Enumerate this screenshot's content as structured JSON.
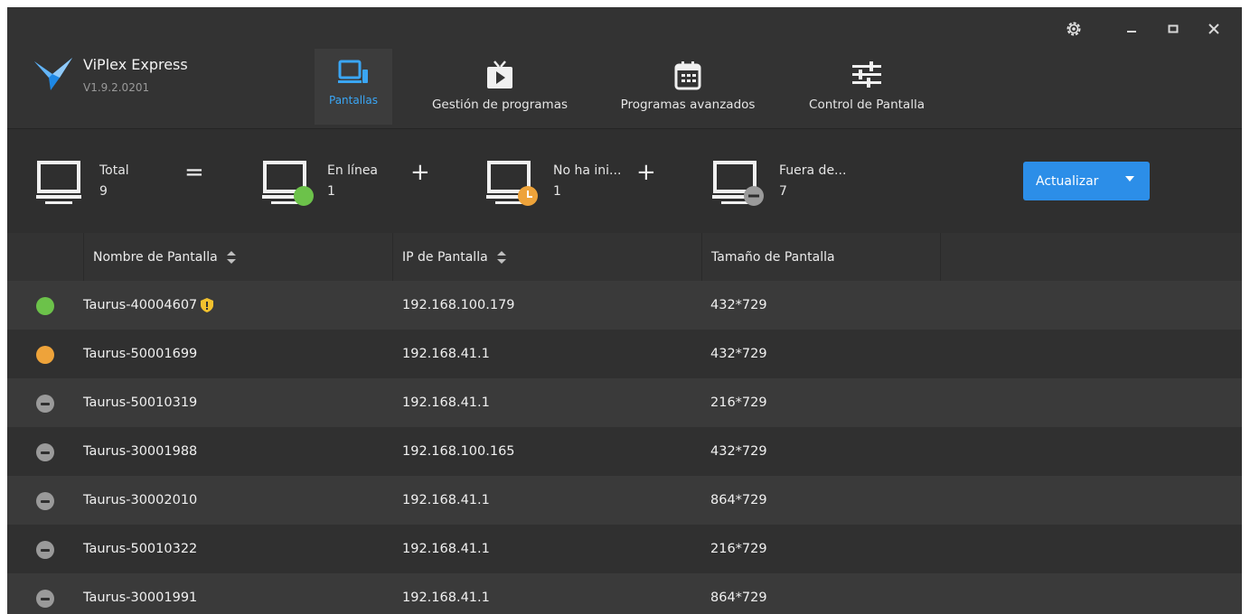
{
  "app": {
    "name": "ViPlex Express",
    "version": "V1.9.2.0201"
  },
  "nav": [
    {
      "label": "Pantallas",
      "icon": "screen-device-icon",
      "active": true
    },
    {
      "label": "Gestión de programas",
      "icon": "play-tv-icon",
      "active": false
    },
    {
      "label": "Programas avanzados",
      "icon": "calendar-icon",
      "active": false
    },
    {
      "label": "Control de Pantalla",
      "icon": "sliders-icon",
      "active": false
    }
  ],
  "summary": {
    "total": {
      "label": "Total",
      "count": "9"
    },
    "online": {
      "label": "En línea",
      "count": "1"
    },
    "not_started": {
      "label": "No ha ini...",
      "count": "1"
    },
    "offline": {
      "label": "Fuera de...",
      "count": "7"
    },
    "equals": "=",
    "plus": "+"
  },
  "refresh_button": {
    "label": "Actualizar"
  },
  "table": {
    "columns": [
      "Nombre de Pantalla",
      "IP de Pantalla",
      "Tamaño de Pantalla"
    ],
    "rows": [
      {
        "status": "online",
        "name": "Taurus-40004607",
        "ip": "192.168.100.179",
        "size": "432*729",
        "warning": true
      },
      {
        "status": "pending",
        "name": "Taurus-50001699",
        "ip": "192.168.41.1",
        "size": "432*729",
        "warning": false
      },
      {
        "status": "offline",
        "name": "Taurus-50010319",
        "ip": "192.168.41.1",
        "size": "216*729",
        "warning": false
      },
      {
        "status": "offline",
        "name": "Taurus-30001988",
        "ip": "192.168.100.165",
        "size": "432*729",
        "warning": false
      },
      {
        "status": "offline",
        "name": "Taurus-30002010",
        "ip": "192.168.41.1",
        "size": "864*729",
        "warning": false
      },
      {
        "status": "offline",
        "name": "Taurus-50010322",
        "ip": "192.168.41.1",
        "size": "216*729",
        "warning": false
      },
      {
        "status": "offline",
        "name": "Taurus-30001991",
        "ip": "192.168.41.1",
        "size": "864*729",
        "warning": false
      }
    ]
  },
  "colors": {
    "accent": "#3aa6f5",
    "button": "#2c8ee8",
    "online": "#6cc24a",
    "pending": "#eea33a",
    "offline": "#9a9a9a"
  }
}
